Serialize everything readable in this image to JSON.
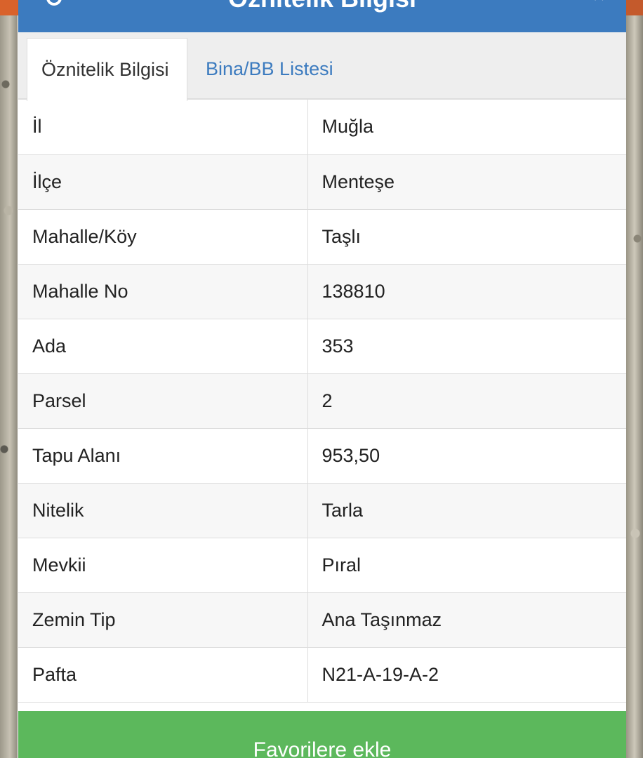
{
  "modal": {
    "title": "Öznitelik Bilgisi",
    "close_glyph": "×"
  },
  "tabs": [
    {
      "label": "Öznitelik Bilgisi",
      "active": true
    },
    {
      "label": "Bina/BB Listesi",
      "active": false
    }
  ],
  "attributes": [
    {
      "key": "İl",
      "value": "Muğla"
    },
    {
      "key": "İlçe",
      "value": "Menteşe"
    },
    {
      "key": "Mahalle/Köy",
      "value": "Taşlı"
    },
    {
      "key": "Mahalle No",
      "value": "138810"
    },
    {
      "key": "Ada",
      "value": "353"
    },
    {
      "key": "Parsel",
      "value": "2"
    },
    {
      "key": "Tapu Alanı",
      "value": "953,50"
    },
    {
      "key": "Nitelik",
      "value": "Tarla"
    },
    {
      "key": "Mevkii",
      "value": "Pıral"
    },
    {
      "key": "Zemin Tip",
      "value": "Ana Taşınmaz"
    },
    {
      "key": "Pafta",
      "value": "N21-A-19-A-2"
    }
  ],
  "actions": {
    "favorite_label": "Favorilere ekle"
  },
  "colors": {
    "header": "#3c7bbf",
    "tab_link": "#3c7bbf",
    "favorite_button": "#5cb85c"
  },
  "icons": {
    "header_left": "location-icon",
    "header_right": "close-icon"
  }
}
